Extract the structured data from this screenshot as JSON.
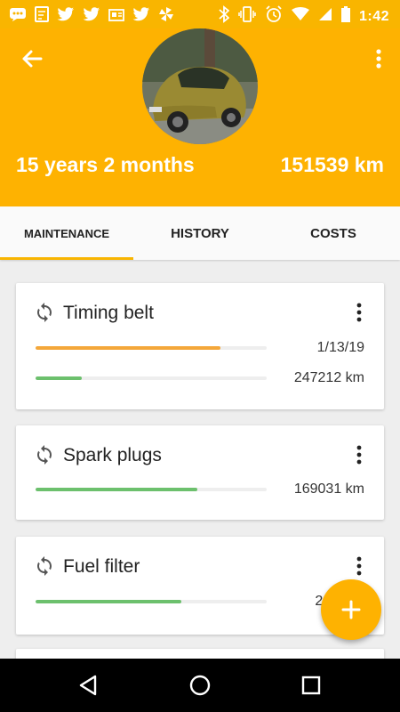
{
  "status_bar": {
    "time": "1:42",
    "left_icons": [
      "chat-icon",
      "note-icon",
      "twitter-icon",
      "twitter-icon",
      "news-icon",
      "twitter-icon",
      "pinwheel-icon"
    ],
    "right_icons": [
      "bluetooth-icon",
      "vibrate-icon",
      "alarm-icon",
      "wifi-icon",
      "signal-icon",
      "battery-icon"
    ]
  },
  "header": {
    "age": "15 years 2 months",
    "mileage": "151539 km",
    "background_color": "#feb201"
  },
  "tabs": [
    {
      "label": "MAINTENANCE",
      "selected": true
    },
    {
      "label": "HISTORY",
      "selected": false
    },
    {
      "label": "COSTS",
      "selected": false
    }
  ],
  "cards": [
    {
      "title": "Timing belt",
      "icon": "repeat-icon",
      "bars": [
        {
          "value": "1/13/19",
          "progress": 0.8,
          "color": "orange"
        },
        {
          "value": "247212 km",
          "progress": 0.2,
          "color": "green"
        }
      ]
    },
    {
      "title": "Spark plugs",
      "icon": "repeat-icon",
      "bars": [
        {
          "value": "169031 km",
          "progress": 0.7,
          "color": "green"
        }
      ]
    },
    {
      "title": "Fuel filter",
      "icon": "repeat-icon",
      "bars": [
        {
          "value": "2400",
          "progress": 0.63,
          "color": "green"
        }
      ]
    }
  ],
  "fab": {
    "icon": "plus-icon"
  },
  "nav_bar": {
    "icons": [
      "back-triangle-icon",
      "home-circle-icon",
      "recents-square-icon"
    ]
  }
}
